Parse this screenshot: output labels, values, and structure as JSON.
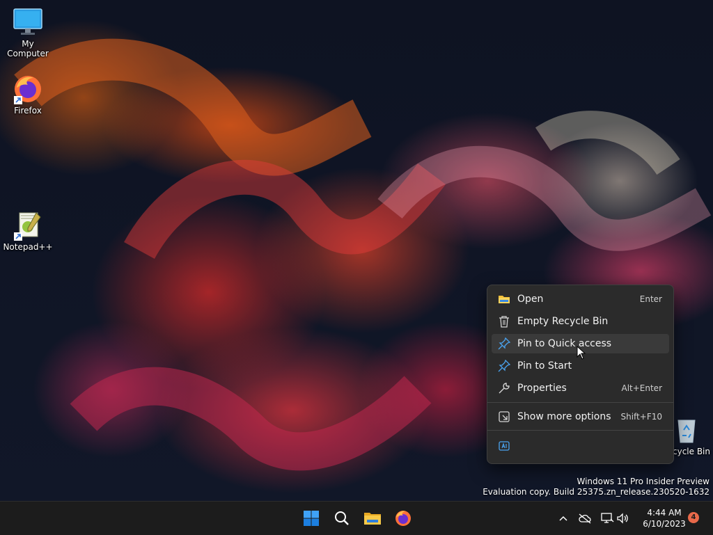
{
  "desktop": {
    "icons": [
      {
        "label": "My Computer",
        "icon": "monitor-icon"
      },
      {
        "label": "Firefox",
        "icon": "firefox-icon"
      },
      {
        "label": "Notepad++",
        "icon": "notepadpp-icon"
      },
      {
        "label": "cycle Bin",
        "icon": "recycle-bin-icon"
      }
    ]
  },
  "context_menu": {
    "items": [
      {
        "label": "Open",
        "shortcut": "Enter",
        "icon": "folder-icon"
      },
      {
        "label": "Empty Recycle Bin",
        "shortcut": "",
        "icon": "trash-icon"
      },
      {
        "label": "Pin to Quick access",
        "shortcut": "",
        "icon": "pin-icon"
      },
      {
        "label": "Pin to Start",
        "shortcut": "",
        "icon": "pin-icon"
      },
      {
        "label": "Properties",
        "shortcut": "Alt+Enter",
        "icon": "wrench-icon"
      },
      {
        "label": "Show more options",
        "shortcut": "Shift+F10",
        "icon": "share-icon"
      }
    ],
    "bottom_icon": "copilot-icon"
  },
  "watermark": {
    "line1": "Windows 11 Pro Insider Preview",
    "line2": "Evaluation copy. Build 25375.zn_release.230520-1632"
  },
  "taskbar": {
    "apps": [
      "start-icon",
      "search-icon",
      "file-explorer-icon",
      "firefox-icon"
    ],
    "tray": [
      "chevron-up-icon",
      "cloud-off-icon",
      "network-icon",
      "volume-icon"
    ],
    "time": "4:44 AM",
    "date": "6/10/2023",
    "notification_count": "4"
  },
  "colors": {
    "menu_bg": "#2b2b2b",
    "taskbar_bg": "#1c1c1c",
    "accent": "#0078d4",
    "badge": "#e8694a"
  }
}
